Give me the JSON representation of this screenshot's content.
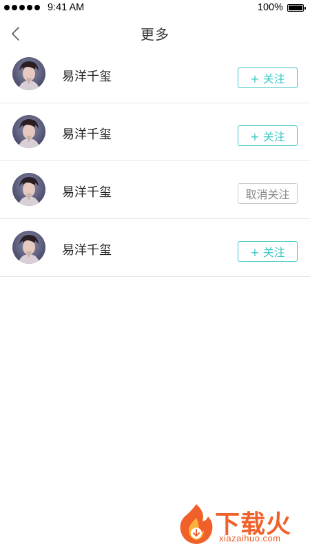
{
  "status_bar": {
    "time": "9:41 AM",
    "battery_percent": "100%"
  },
  "nav": {
    "title": "更多",
    "back_icon": "chevron-left-icon"
  },
  "users": [
    {
      "name": "易洋千玺",
      "button_label": "+ 关注",
      "followed": false
    },
    {
      "name": "易洋千玺",
      "button_label": "+ 关注",
      "followed": false
    },
    {
      "name": "易洋千玺",
      "button_label": "取消关注",
      "followed": true
    },
    {
      "name": "易洋千玺",
      "button_label": "+ 关注",
      "followed": false
    }
  ],
  "watermark": {
    "title": "下载火",
    "subtitle": "xiazaihuo.com"
  },
  "colors": {
    "accent": "#3cc6c4",
    "unfollow_border": "#c8c8c8",
    "divider": "#e6e6e6",
    "watermark": "#f0602a"
  }
}
